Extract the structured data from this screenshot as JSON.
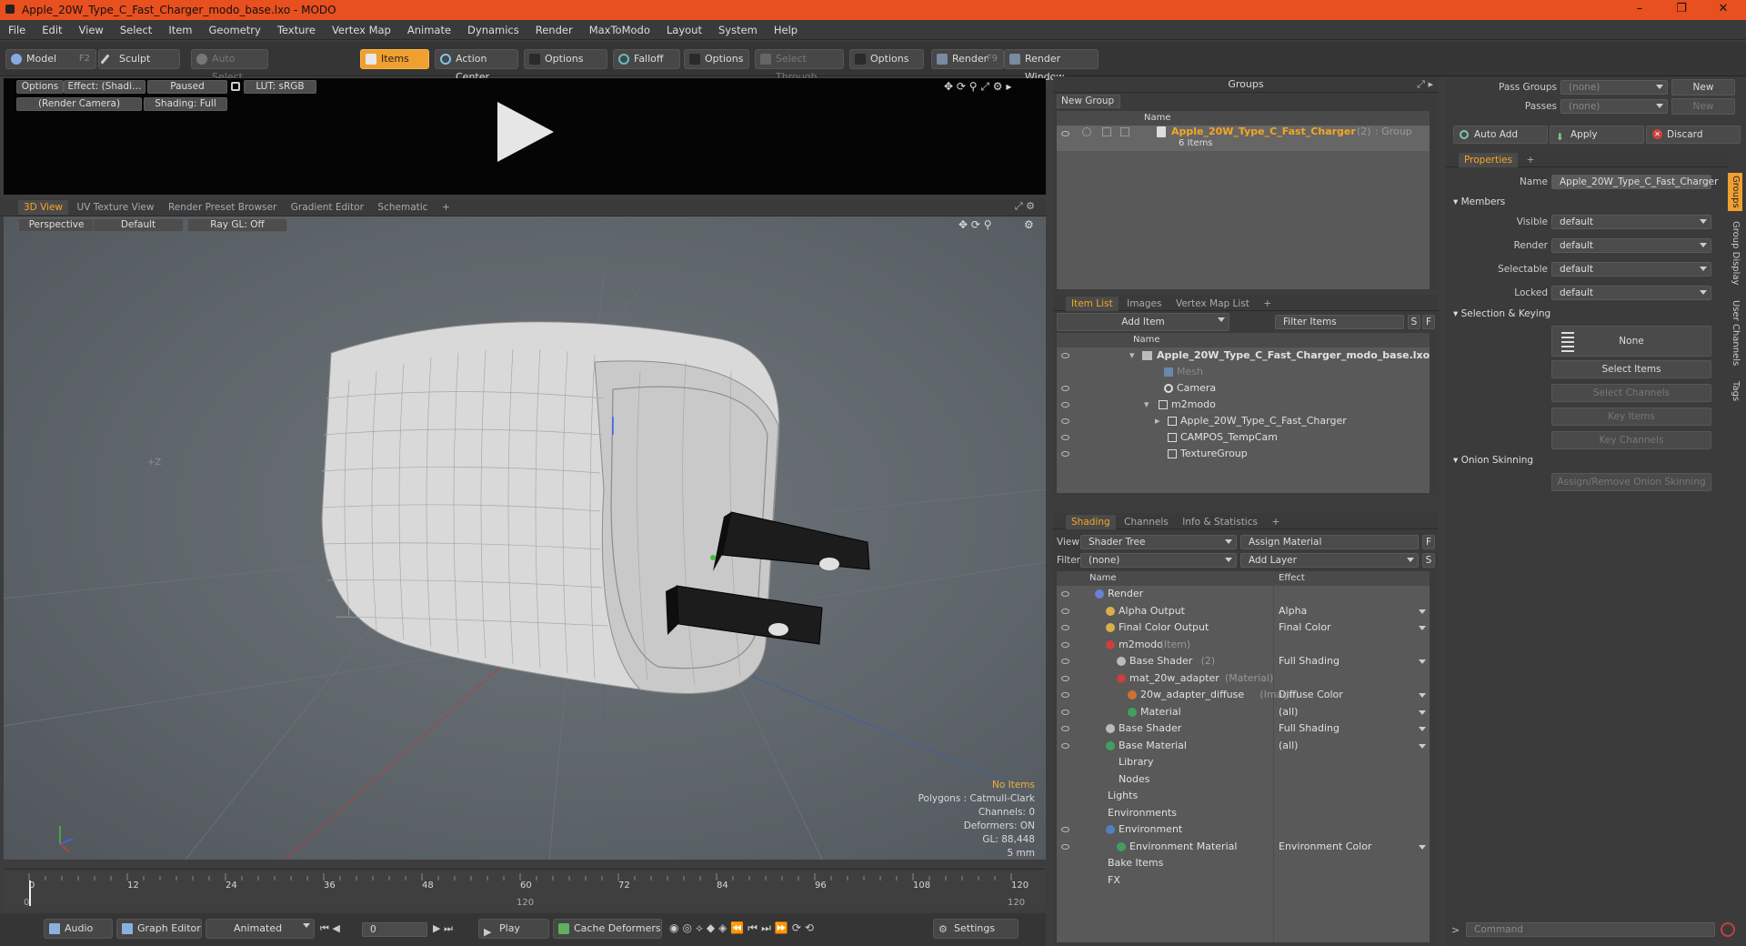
{
  "window": {
    "title": "Apple_20W_Type_C_Fast_Charger_modo_base.lxo - MODO",
    "min": "–",
    "max": "❐",
    "close": "✕"
  },
  "menu": [
    "File",
    "Edit",
    "View",
    "Select",
    "Item",
    "Geometry",
    "Texture",
    "Vertex Map",
    "Animate",
    "Dynamics",
    "Render",
    "MaxToModo",
    "Layout",
    "System",
    "Help"
  ],
  "toolbar": {
    "model": "Model",
    "model_key": "F2",
    "sculpt": "Sculpt",
    "auto_select": "Auto Select",
    "items": "Items",
    "action_center": "Action Center",
    "options1": "Options",
    "falloff": "Falloff",
    "options2": "Options",
    "select_through": "Select Through",
    "options3": "Options",
    "render": "Render",
    "render_key": "F9",
    "render_window": "Render Window"
  },
  "preview": {
    "options": "Options",
    "effect": "Effect: (Shadi…",
    "paused": "Paused",
    "lut": "LUT: sRGB",
    "camera": "(Render Camera)",
    "shading": "Shading: Full"
  },
  "viewport": {
    "tabs": [
      "3D View",
      "UV Texture View",
      "Render Preset Browser",
      "Gradient Editor",
      "Schematic",
      "+"
    ],
    "perspective": "Perspective",
    "default": "Default",
    "raygl": "Ray GL: Off",
    "axis_z": "+Z",
    "info": {
      "no_items": "No Items",
      "polygons": "Polygons : Catmull-Clark",
      "channels": "Channels: 0",
      "deformers": "Deformers: ON",
      "gl": "GL: 88,448",
      "scale": "5 mm"
    }
  },
  "timeline": {
    "ticks": [
      "0",
      "12",
      "24",
      "36",
      "48",
      "60",
      "72",
      "84",
      "96",
      "108",
      "120"
    ],
    "sub_left": "0",
    "sub_mid": "120",
    "sub_right": "120"
  },
  "bottombar": {
    "audio": "Audio",
    "graph_editor": "Graph Editor",
    "animated": "Animated",
    "frame": "0",
    "play": "Play",
    "cache_deformers": "Cache Deformers",
    "settings": "Settings"
  },
  "groups": {
    "title": "Groups",
    "new_group": "New Group",
    "col_name": "Name",
    "item_name": "Apple_20W_Type_C_Fast_Charger",
    "item_count": "(2)",
    "item_type": ": Group",
    "item_sub": "6 Items"
  },
  "itemlist": {
    "tabs": [
      "Item List",
      "Images",
      "Vertex Map List",
      "+"
    ],
    "add_item": "Add Item",
    "filter": "Filter Items",
    "s": "S",
    "f": "F",
    "col_name": "Name",
    "rows": [
      {
        "label": "Apple_20W_Type_C_Fast_Charger_modo_base.lxo",
        "indent": 0,
        "bold": true
      },
      {
        "label": "Mesh",
        "indent": 1,
        "dim": true
      },
      {
        "label": "Camera",
        "indent": 1
      },
      {
        "label": "m2modo",
        "indent": 1
      },
      {
        "label": "Apple_20W_Type_C_Fast_Charger",
        "indent": 2
      },
      {
        "label": "CAMPOS_TempCam",
        "indent": 2
      },
      {
        "label": "TextureGroup",
        "indent": 2
      }
    ]
  },
  "shading": {
    "tabs": [
      "Shading",
      "Channels",
      "Info & Statistics",
      "+"
    ],
    "view_label": "View",
    "view_value": "Shader Tree",
    "assign_material": "Assign Material",
    "f": "F",
    "filter_label": "Filter",
    "filter_value": "(none)",
    "add_layer": "Add Layer",
    "s": "S",
    "col_name": "Name",
    "col_effect": "Effect",
    "rows": [
      {
        "name": "Render",
        "suffix": "",
        "effect": "",
        "indent": 0,
        "color": "#6a7fd8"
      },
      {
        "name": "Alpha Output",
        "suffix": "",
        "effect": "Alpha",
        "indent": 1,
        "color": "#d8b04a"
      },
      {
        "name": "Final Color Output",
        "suffix": "",
        "effect": "Final Color",
        "indent": 1,
        "color": "#d8b04a"
      },
      {
        "name": "m2modo",
        "suffix": "(Item)",
        "effect": "",
        "indent": 1,
        "color": "#c84040"
      },
      {
        "name": "Base Shader",
        "suffix": "(2)",
        "effect": "Full Shading",
        "indent": 2,
        "color": "#bbbbbb"
      },
      {
        "name": "mat_20w_adapter",
        "suffix": "(Material)",
        "effect": "",
        "indent": 2,
        "color": "#c84040"
      },
      {
        "name": "20w_adapter_diffuse",
        "suffix": "(Image)",
        "effect": "Diffuse Color",
        "indent": 3,
        "color": "#d07030"
      },
      {
        "name": "Material",
        "suffix": "",
        "effect": "(all)",
        "indent": 3,
        "color": "#40a060"
      },
      {
        "name": "Base Shader",
        "suffix": "",
        "effect": "Full Shading",
        "indent": 1,
        "color": "#bbbbbb"
      },
      {
        "name": "Base Material",
        "suffix": "",
        "effect": "(all)",
        "indent": 1,
        "color": "#40a060"
      },
      {
        "name": "Library",
        "suffix": "",
        "effect": "",
        "indent": 1,
        "color": ""
      },
      {
        "name": "Nodes",
        "suffix": "",
        "effect": "",
        "indent": 1,
        "color": ""
      },
      {
        "name": "Lights",
        "suffix": "",
        "effect": "",
        "indent": 0,
        "color": ""
      },
      {
        "name": "Environments",
        "suffix": "",
        "effect": "",
        "indent": 0,
        "color": ""
      },
      {
        "name": "Environment",
        "suffix": "",
        "effect": "",
        "indent": 1,
        "color": "#5080c0"
      },
      {
        "name": "Environment Material",
        "suffix": "",
        "effect": "Environment Color",
        "indent": 2,
        "color": "#40a060"
      },
      {
        "name": "Bake Items",
        "suffix": "",
        "effect": "",
        "indent": 0,
        "color": ""
      },
      {
        "name": "FX",
        "suffix": "",
        "effect": "",
        "indent": 0,
        "color": ""
      }
    ]
  },
  "props": {
    "pass_groups": "Pass Groups",
    "passes": "Passes",
    "none": "(none)",
    "new": "New",
    "auto_add": "Auto Add",
    "apply": "Apply",
    "discard": "Discard",
    "tab": "Properties",
    "name_label": "Name",
    "name_value": "Apple_20W_Type_C_Fast_Charger",
    "members": "Members",
    "visible": "Visible",
    "render": "Render",
    "selectable": "Selectable",
    "locked": "Locked",
    "default": "default",
    "sel_keying": "Selection & Keying",
    "none_btn": "None",
    "select_items": "Select Items",
    "select_channels": "Select Channels",
    "key_items": "Key Items",
    "key_channels": "Key Channels",
    "onion": "Onion Skinning",
    "assign_onion": "Assign/Remove Onion Skinning",
    "side_tabs": [
      "Groups",
      "Group Display",
      "User Channels",
      "Tags"
    ],
    "command": "Command"
  }
}
